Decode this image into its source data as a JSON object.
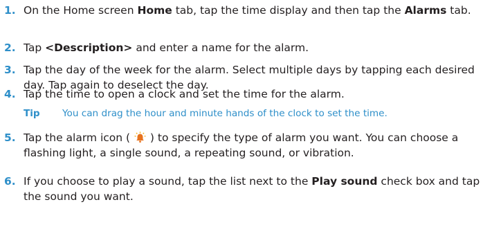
{
  "steps": [
    {
      "num": "1.",
      "parts": [
        {
          "t": "On the Home screen "
        },
        {
          "t": "Home",
          "b": true
        },
        {
          "t": " tab, tap the time display and then tap the "
        },
        {
          "t": "Alarms",
          "b": true
        },
        {
          "t": " tab."
        }
      ]
    },
    {
      "num": "2.",
      "parts": [
        {
          "t": "Tap "
        },
        {
          "t": "<Description>",
          "b": true
        },
        {
          "t": " and enter a name for the alarm."
        }
      ]
    },
    {
      "num": "3.",
      "parts": [
        {
          "t": "Tap the day of the week for the alarm. Select multiple days by tapping each desired day. Tap again to deselect the day."
        }
      ]
    },
    {
      "num": "4.",
      "parts": [
        {
          "t": "Tap the time to open a clock and set the time for the alarm."
        }
      ]
    },
    {
      "num": "5.",
      "parts": [
        {
          "t": "Tap the alarm icon ( "
        },
        {
          "icon": "alarm-bell-icon"
        },
        {
          "t": " ) to specify the type of alarm you want. You can choose a flashing light, a single sound, a repeating sound, or vibration."
        }
      ]
    },
    {
      "num": "6.",
      "parts": [
        {
          "t": "If you choose to play a sound, tap the list next to the "
        },
        {
          "t": "Play sound",
          "b": true
        },
        {
          "t": " check box and tap the sound you want."
        }
      ]
    }
  ],
  "tip": {
    "label": "Tip",
    "text": "You can drag the hour and minute hands of the clock to set the time."
  },
  "colors": {
    "accent": "#2e8fc9",
    "body_text": "#231f20",
    "icon_orange": "#e8731e"
  }
}
